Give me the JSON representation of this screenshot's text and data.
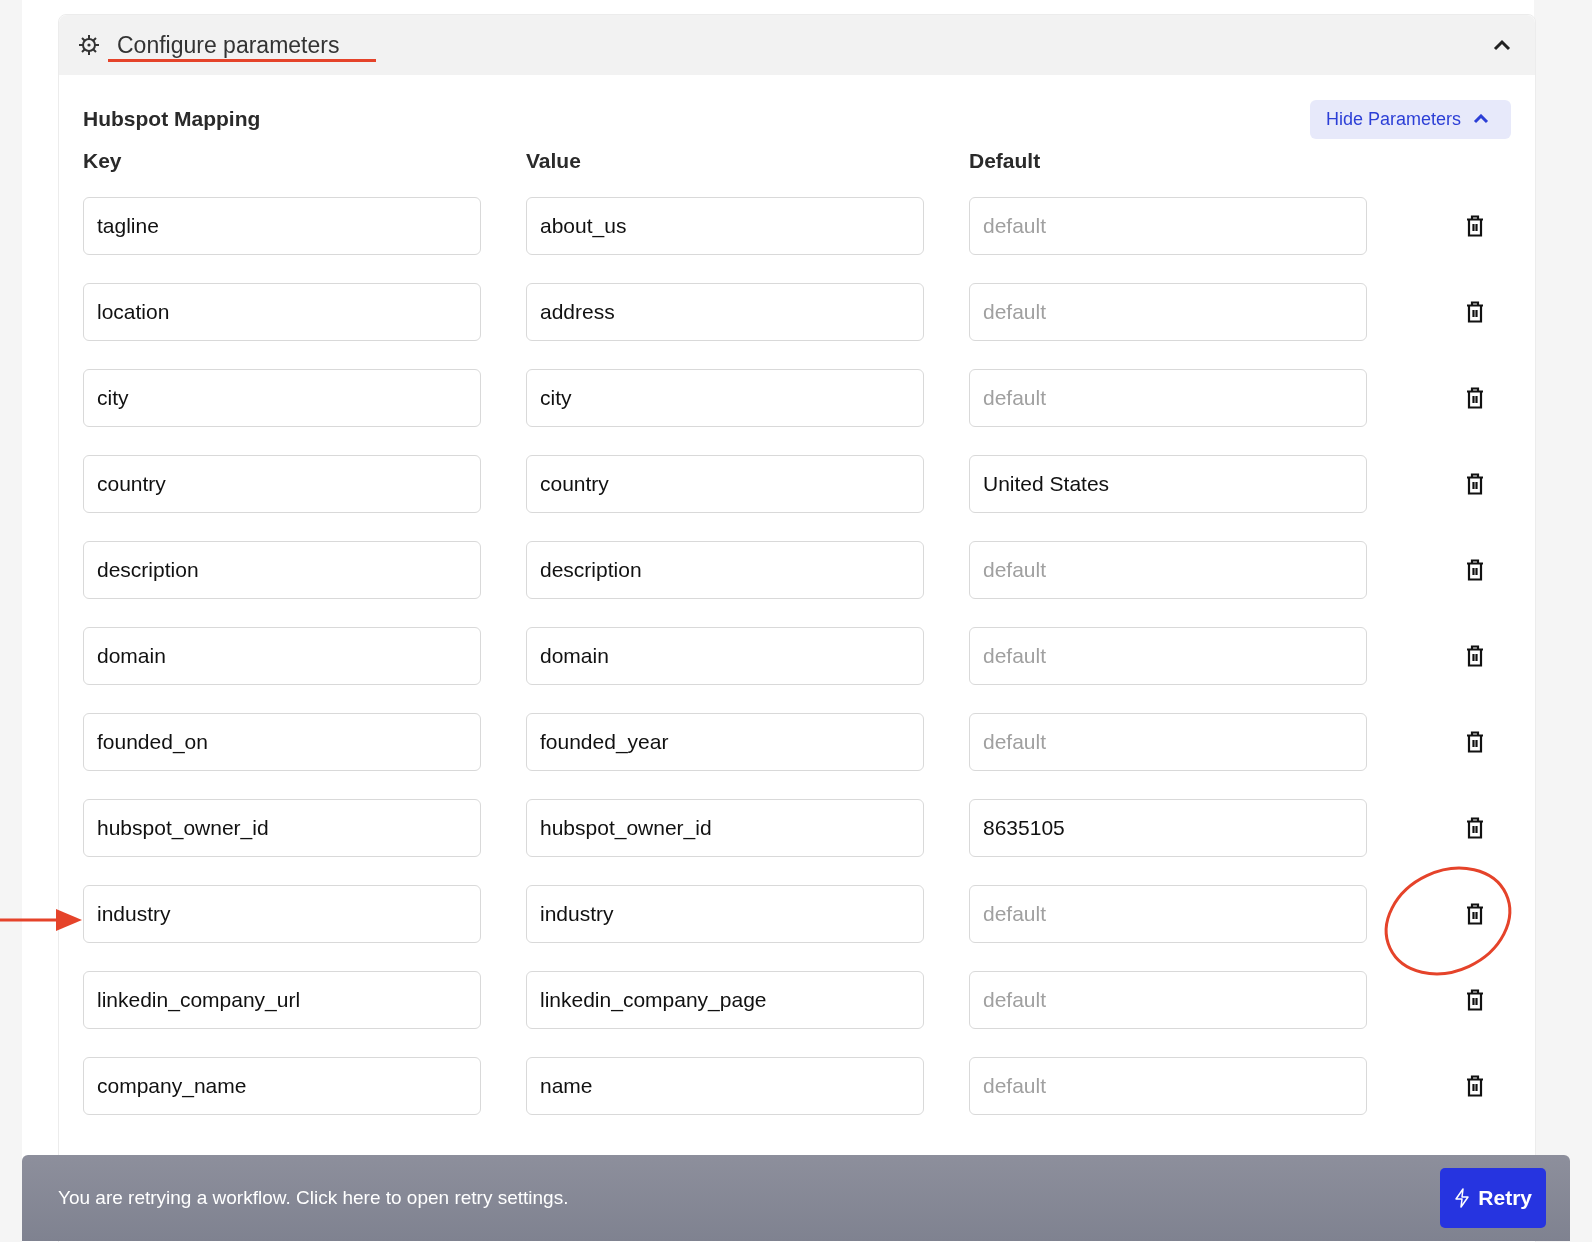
{
  "section": {
    "title": "Configure parameters",
    "expanded": true
  },
  "mapping": {
    "title": "Hubspot Mapping",
    "toggle_button": "Hide Parameters",
    "columns": [
      "Key",
      "Value",
      "Default"
    ],
    "rows": [
      {
        "key": "tagline",
        "value": "about_us",
        "placeholder": "default"
      },
      {
        "key": "location",
        "value": "address",
        "placeholder": "default"
      },
      {
        "key": "city",
        "value": "city",
        "placeholder": "default"
      },
      {
        "key": "country",
        "value": "country",
        "default": "United States"
      },
      {
        "key": "description",
        "value": "description",
        "placeholder": "default"
      },
      {
        "key": "domain",
        "value": "domain",
        "placeholder": "default"
      },
      {
        "key": "founded_on",
        "value": "founded_year",
        "placeholder": "default"
      },
      {
        "key": "hubspot_owner_id",
        "value": "hubspot_owner_id",
        "default": "8635105"
      },
      {
        "key": "industry",
        "value": "industry",
        "placeholder": "default"
      },
      {
        "key": "linkedin_company_url",
        "value": "linkedin_company_page",
        "placeholder": "default"
      },
      {
        "key": "company_name",
        "value": "name",
        "placeholder": "default"
      }
    ]
  },
  "retry_bar": {
    "message": "You are retrying a workflow. Click here to open retry settings.",
    "button": "Retry"
  }
}
